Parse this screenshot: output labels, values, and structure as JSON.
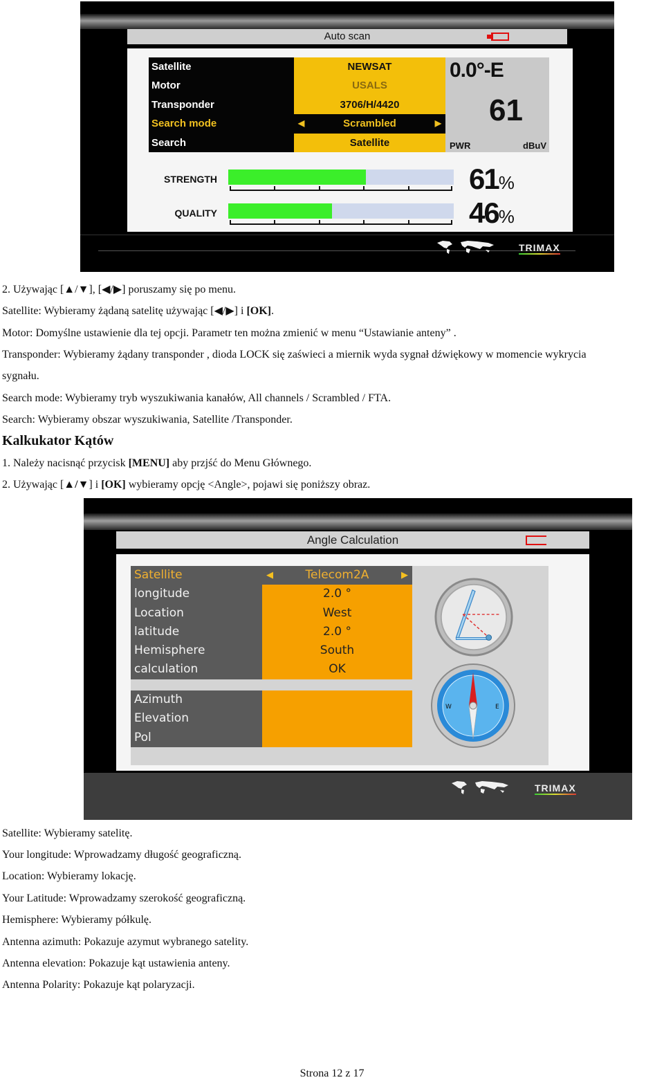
{
  "screen1": {
    "title": "Auto scan",
    "menu": [
      {
        "label": "Satellite",
        "value": "NEWSAT",
        "active": false,
        "dim": false
      },
      {
        "label": "Motor",
        "value": "USALS",
        "active": false,
        "dim": true
      },
      {
        "label": "Transponder",
        "value": "3706/H/4420",
        "active": false,
        "dim": false
      },
      {
        "label": "Search mode",
        "value": "Scrambled",
        "active": true,
        "dim": false
      },
      {
        "label": "Search",
        "value": "Satellite",
        "active": false,
        "dim": false
      }
    ],
    "arrow_left": "◀",
    "arrow_right": "▶",
    "readout": {
      "position": "0.0°-E",
      "value": "61",
      "label": "PWR",
      "unit": "dBuV"
    },
    "meters": [
      {
        "label": "STRENGTH",
        "percent": 61,
        "display": "61"
      },
      {
        "label": "QUALITY",
        "percent": 46,
        "display": "46"
      }
    ],
    "percent_sign": "%",
    "brand": "TRIMAX",
    "colors": {
      "accent": "#f3bf0a",
      "bar_fill": "#3bee2a",
      "bar_track": "#cfd8ec",
      "battery": "#e01010"
    }
  },
  "text1": {
    "line1": "2. Używając [▲/▼], [◀/▶] poruszamy się po menu.",
    "line2_pre": "Satellite: Wybieramy żądaną satelitę używając [",
    "line2_keys": "◀/▶",
    "line2_mid": "] i ",
    "line2_ok": "[OK]",
    "line2_end": ".",
    "line3": "Motor: Domyślne ustawienie dla tej opcji. Parametr ten można zmienić w menu “Ustawianie anteny” .",
    "line4": "Transponder: Wybieramy żądany transponder , dioda LOCK się zaświeci a miernik wyda sygnał dźwiękowy w momencie wykrycia",
    "line5": "sygnału.",
    "line6": "Search mode: Wybieramy tryb wyszukiwania kanałów, All channels / Scrambled / FTA.",
    "line7": "Search: Wybieramy obszar wyszukiwania, Satellite /Transponder."
  },
  "heading": "Kalkukator Kątów",
  "text2": {
    "line1_pre": "1. Należy nacisnąć przycisk ",
    "line1_key": "[MENU]",
    "line1_end": " aby przjść do Menu Głównego.",
    "line2_pre": "2. Używając [",
    "line2_keys": "▲/▼",
    "line2_mid": "]  i ",
    "line2_ok": "[OK]",
    "line2_end": " wybieramy opcję <Angle>, pojawi się poniższy obraz."
  },
  "screen2": {
    "title": "Angle Calculation",
    "menu": [
      {
        "label": "Satellite",
        "value": "Telecom2A",
        "active": true
      },
      {
        "label": "longitude",
        "value": "2.0 °",
        "active": false
      },
      {
        "label": "Location",
        "value": "West",
        "active": false
      },
      {
        "label": "latitude",
        "value": "2.0 °",
        "active": false
      },
      {
        "label": "Hemisphere",
        "value": "South",
        "active": false
      },
      {
        "label": "calculation",
        "value": "OK",
        "active": false
      }
    ],
    "results": [
      {
        "label": "Azimuth",
        "value": ""
      },
      {
        "label": "Elevation",
        "value": ""
      },
      {
        "label": "Pol",
        "value": ""
      }
    ],
    "brand": "TRIMAX",
    "colors": {
      "accent": "#f6a000",
      "label_bg": "#5a5a5a"
    }
  },
  "text3": [
    "Satellite: Wybieramy satelitę.",
    "Your longitude: Wprowadzamy długość geograficzną.",
    "Location: Wybieramy lokację.",
    "Your Latitude: Wprowadzamy szerokość geograficzną.",
    "Hemisphere: Wybieramy półkulę.",
    "Antenna azimuth: Pokazuje azymut wybranego satelity.",
    "Antenna elevation: Pokazuje kąt ustawienia anteny.",
    "Antenna Polarity: Pokazuje kąt polaryzacji."
  ],
  "footer": {
    "page": "Strona 12 z 17"
  }
}
